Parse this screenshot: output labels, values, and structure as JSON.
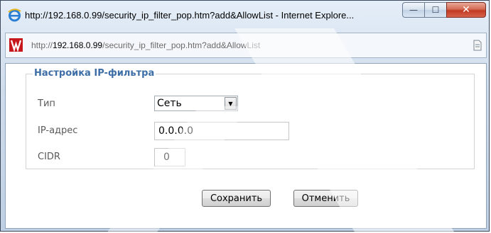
{
  "window": {
    "title": "http://192.168.0.99/security_ip_filter_pop.htm?add&AllowList - Internet Explore...",
    "minimize_glyph": "—",
    "maximize_glyph": "☐",
    "close_glyph": "✕"
  },
  "addressbar": {
    "prefix": "http://",
    "host": "192.168.0.99",
    "path": "/security_ip_filter_pop.htm?add&AllowList"
  },
  "form": {
    "legend": "Настройка IP-фильтра",
    "type_label": "Тип",
    "type_value": "Сеть",
    "ip_label": "IP-адрес",
    "ip_value": "0.0.0.0",
    "cidr_label": "CIDR",
    "cidr_value": "0"
  },
  "buttons": {
    "save": "Сохранить",
    "cancel": "Отменить"
  },
  "icons": {
    "browser": "internet-explorer-icon",
    "site": "site-favicon-icon",
    "page": "document-icon",
    "dropdown": "triangle-down-icon"
  },
  "colors": {
    "legend": "#3d6ea6",
    "close_button": "#c13a22",
    "watermark": "#f2f2f2"
  }
}
